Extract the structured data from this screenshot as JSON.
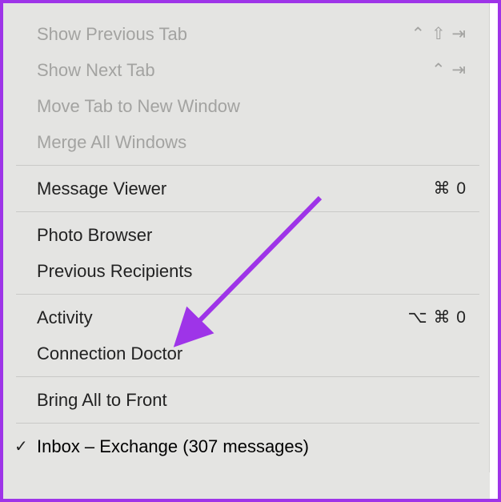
{
  "menu": {
    "group1": [
      {
        "label": "Show Previous Tab",
        "shortcut": "⌃ ⇧ ⇥",
        "enabled": false
      },
      {
        "label": "Show Next Tab",
        "shortcut": "⌃ ⇥",
        "enabled": false
      },
      {
        "label": "Move Tab to New Window",
        "shortcut": "",
        "enabled": false
      },
      {
        "label": "Merge All Windows",
        "shortcut": "",
        "enabled": false
      }
    ],
    "group2": [
      {
        "label": "Message Viewer",
        "shortcut": "⌘ 0",
        "enabled": true
      }
    ],
    "group3": [
      {
        "label": "Photo Browser",
        "shortcut": "",
        "enabled": true
      },
      {
        "label": "Previous Recipients",
        "shortcut": "",
        "enabled": true
      }
    ],
    "group4": [
      {
        "label": "Activity",
        "shortcut": "⌥ ⌘ 0",
        "enabled": true
      },
      {
        "label": "Connection Doctor",
        "shortcut": "",
        "enabled": true
      }
    ],
    "group5": [
      {
        "label": "Bring All to Front",
        "shortcut": "",
        "enabled": true
      }
    ],
    "windows": [
      {
        "label": "Inbox – Exchange (307 messages)",
        "checked": true
      }
    ]
  },
  "annotation": {
    "color": "#9e34e8"
  }
}
